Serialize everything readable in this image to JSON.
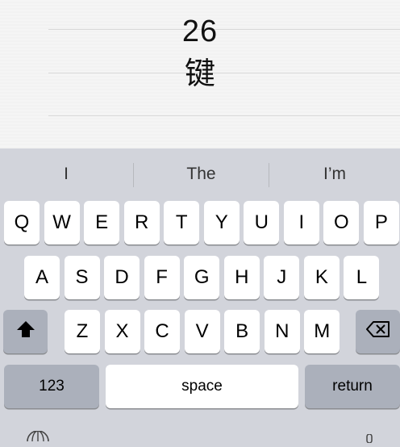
{
  "title": {
    "line1": "26",
    "line2": "键"
  },
  "predictive": [
    "I",
    "The",
    "I’m"
  ],
  "rows": [
    [
      "Q",
      "W",
      "E",
      "R",
      "T",
      "Y",
      "U",
      "I",
      "O",
      "P"
    ],
    [
      "A",
      "S",
      "D",
      "F",
      "G",
      "H",
      "J",
      "K",
      "L"
    ],
    [
      "Z",
      "X",
      "C",
      "V",
      "B",
      "N",
      "M"
    ]
  ],
  "keys": {
    "numbers": "123",
    "space": "space",
    "return": "return",
    "shift_icon": "shift-icon",
    "delete_icon": "delete-icon",
    "globe_icon": "globe-icon"
  },
  "colors": {
    "key": "#ffffff",
    "function_key": "#abb0bb",
    "keyboard_bg": "#d2d4db",
    "page_bg": "#f5f5f5"
  }
}
